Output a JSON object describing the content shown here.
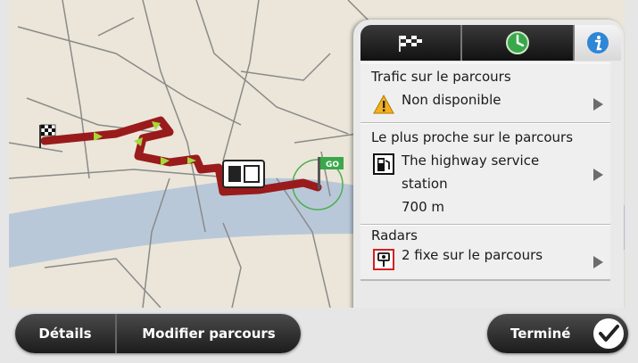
{
  "map": {
    "arrival_label": "GO"
  },
  "tabs": [
    {
      "name": "route-summary",
      "icon": "checkered-flag-icon"
    },
    {
      "name": "eta",
      "icon": "green-clock-icon"
    },
    {
      "name": "info",
      "icon": "info-icon",
      "selected": true
    }
  ],
  "traffic": {
    "title": "Trafic sur le parcours",
    "value": "Non disponible",
    "icon": "warning-icon"
  },
  "nearest": {
    "title": "Le plus proche sur le parcours",
    "line1": "The highway service",
    "line2": "station",
    "distance": "700 m",
    "icon": "service-station-icon"
  },
  "radars": {
    "title": "Radars",
    "value": "2 fixe sur le parcours",
    "icon": "speed-camera-icon"
  },
  "buttons": {
    "details": "Détails",
    "modify": "Modifier parcours",
    "done": "Terminé"
  },
  "colors": {
    "route": "#9a1b1b",
    "route_arrows": "#a5d83a",
    "info_blue": "#2f86d6",
    "eta_green": "#3aa84a",
    "water": "#b9c8d9",
    "map_land": "#ebe6d9",
    "warning": "#f2b01e"
  }
}
